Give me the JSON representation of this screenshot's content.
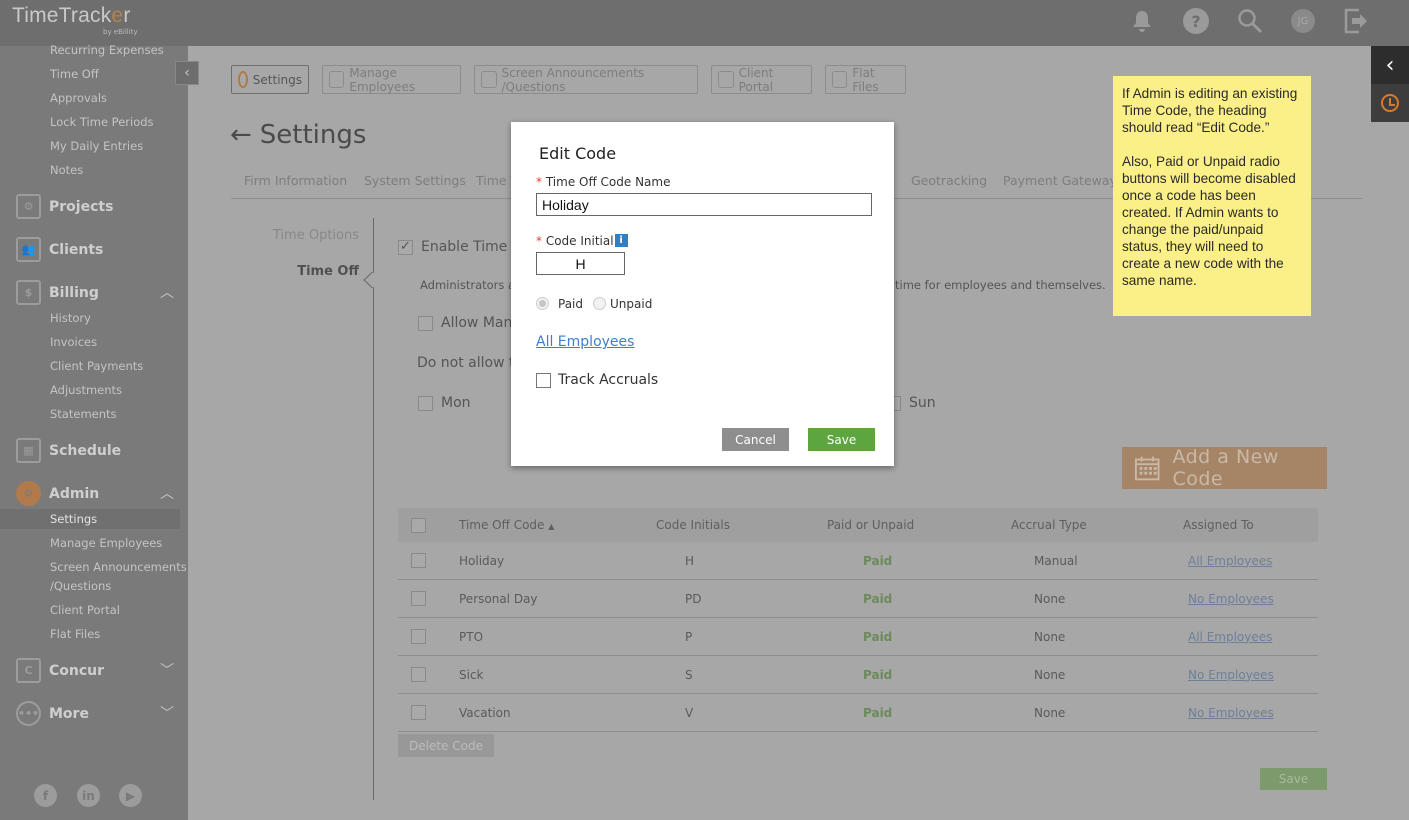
{
  "app": {
    "title": "TimeTracker",
    "title_pre": "TimeTrack",
    "title_o": "e",
    "title_post": "r",
    "subtitle": "by eBillity",
    "user_initials": "JG"
  },
  "topbar": {
    "icons": [
      "bell-icon",
      "help-icon",
      "search-icon",
      "avatar",
      "logout-icon"
    ],
    "help_glyph": "?"
  },
  "sidebar": {
    "time_sub": [
      "Recurring Expenses",
      "Time Off",
      "Approvals",
      "Lock Time Periods",
      "My Daily Entries",
      "Notes"
    ],
    "projects": "Projects",
    "clients": "Clients",
    "billing": "Billing",
    "billing_sub": [
      "History",
      "Invoices",
      "Client Payments",
      "Adjustments",
      "Statements"
    ],
    "schedule": "Schedule",
    "admin": "Admin",
    "admin_sub": [
      "Settings",
      "Manage Employees",
      "Screen Announcements",
      "/Questions",
      "Client Portal",
      "Flat Files"
    ],
    "concur": "Concur",
    "more": "More",
    "social": [
      "f",
      "in",
      "▶"
    ],
    "active_item": "Settings"
  },
  "subnav": [
    "Settings",
    "Manage Employees",
    "Screen Announcements /Questions",
    "Client Portal",
    "Flat Files"
  ],
  "page": {
    "title": "Settings",
    "tabs": [
      "Firm Information",
      "System Settings",
      "Time T",
      "Geotracking",
      "Payment Gateway"
    ],
    "left_nav": [
      "Time Options",
      "Time Off"
    ],
    "left_nav_active": "Time Off",
    "enable_label": "Enable Time O",
    "admin_text_left": "Administrators ar",
    "admin_text_right": "time for employees and themselves.",
    "allow_label": "Allow Mana",
    "do_not_allow": "Do not allow ti",
    "days": [
      "Mon",
      "Sun"
    ],
    "add_code_label": "Add a New Code",
    "delete_code_label": "Delete Code",
    "save_label": "Save"
  },
  "table": {
    "headers": [
      "Time Off Code",
      "Code Initials",
      "Paid or Unpaid",
      "Accrual Type",
      "Assigned To"
    ],
    "sort_indicator": "▲",
    "rows": [
      {
        "code": "Holiday",
        "initials": "H",
        "paid": "Paid",
        "accrual": "Manual",
        "assigned": "All Employees"
      },
      {
        "code": "Personal Day",
        "initials": "PD",
        "paid": "Paid",
        "accrual": "None",
        "assigned": "No Employees"
      },
      {
        "code": "PTO",
        "initials": "P",
        "paid": "Paid",
        "accrual": "None",
        "assigned": "All Employees"
      },
      {
        "code": "Sick",
        "initials": "S",
        "paid": "Paid",
        "accrual": "None",
        "assigned": "No Employees"
      },
      {
        "code": "Vacation",
        "initials": "V",
        "paid": "Paid",
        "accrual": "None",
        "assigned": "No Employees"
      }
    ]
  },
  "modal": {
    "title": "Edit Code",
    "required_mark": "*",
    "name_label": "Time Off Code Name",
    "name_value": "Holiday",
    "initial_label": "Code Initial",
    "info_glyph": "i",
    "initial_value": "H",
    "paid_label": "Paid",
    "unpaid_label": "Unpaid",
    "selected": "Paid",
    "employees_link": "All Employees",
    "track_accruals_label": "Track Accruals",
    "track_accruals_checked": false,
    "cancel_label": "Cancel",
    "save_label": "Save"
  },
  "note": {
    "p1": "If Admin is editing an existing Time Code, the heading should read “Edit Code.”",
    "p2": "Also, Paid or Unpaid radio buttons will become disabled once a code has been created. If Admin wants to change the paid/unpaid status, they will need to create a new code with the same name."
  },
  "colors": {
    "accent_orange": "#d77a2d",
    "save_green": "#5da53f",
    "link_blue": "#3f7fc9",
    "note_yellow": "#fbef87"
  }
}
